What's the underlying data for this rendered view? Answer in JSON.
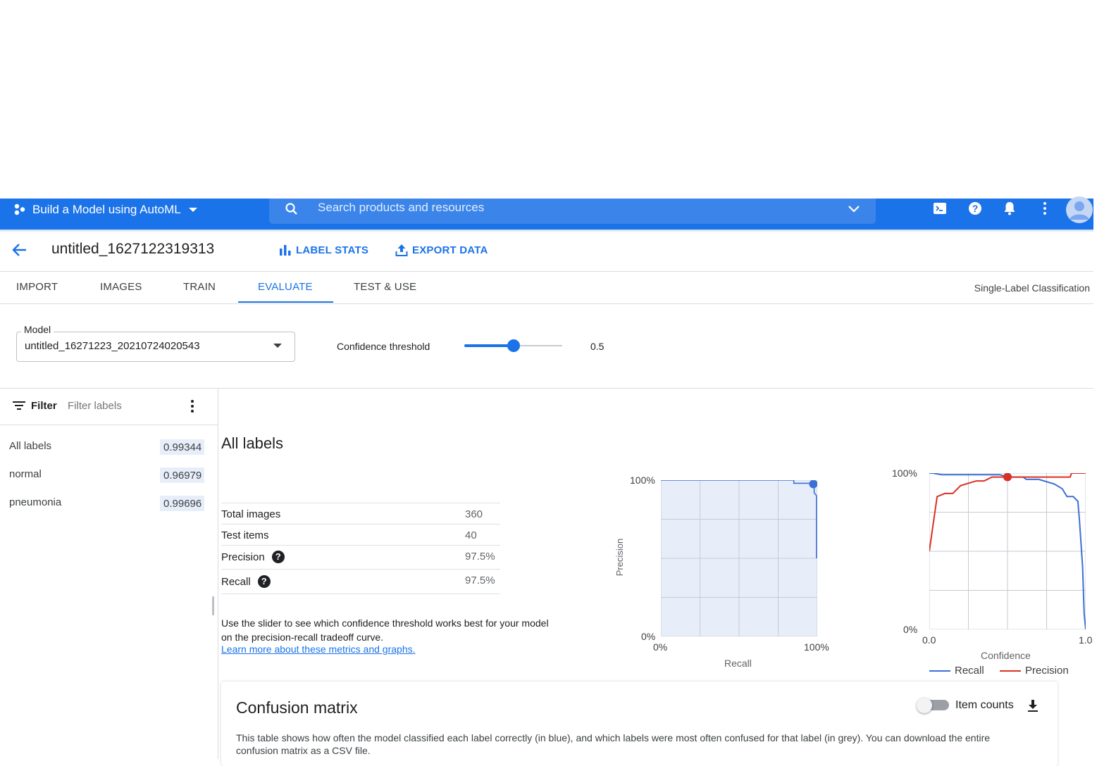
{
  "topbar": {
    "project": "Build a Model using AutoML",
    "search_placeholder": "Search products and resources",
    "icons": [
      "cloud-shell-icon",
      "help-icon",
      "notifications-icon",
      "more-vert-icon",
      "account-avatar"
    ]
  },
  "header": {
    "title": "untitled_1627122319313",
    "label_stats": "LABEL STATS",
    "export_data": "EXPORT DATA"
  },
  "tabs": [
    {
      "label": "IMPORT",
      "active": false
    },
    {
      "label": "IMAGES",
      "active": false
    },
    {
      "label": "TRAIN",
      "active": false
    },
    {
      "label": "EVALUATE",
      "active": true
    },
    {
      "label": "TEST & USE",
      "active": false
    }
  ],
  "task_type": "Single-Label Classification",
  "model_select": {
    "label": "Model",
    "value": "untitled_16271223_20210724020543"
  },
  "confidence": {
    "label": "Confidence threshold",
    "value": "0.5",
    "fraction": 0.5
  },
  "filter": {
    "label": "Filter",
    "placeholder": "Filter labels"
  },
  "labels": [
    {
      "name": "All labels",
      "score": "0.99344"
    },
    {
      "name": "normal",
      "score": "0.96979"
    },
    {
      "name": "pneumonia",
      "score": "0.99696"
    }
  ],
  "section_title": "All labels",
  "metrics": [
    {
      "key": "Total images",
      "value": "360"
    },
    {
      "key": "Test items",
      "value": "40"
    },
    {
      "key": "Precision",
      "value": "97.5%"
    },
    {
      "key": "Recall",
      "value": "97.5%"
    }
  ],
  "description": "Use the slider to see which confidence threshold works best for your model on the precision-recall tradeoff curve.",
  "learn_more": "Learn more about these metrics and graphs.",
  "charts_text": {
    "pr_y_top": "100%",
    "pr_y_bottom": "0%",
    "pr_x_left": "0%",
    "pr_x_right": "100%",
    "pr_xlabel": "Recall",
    "pr_ylabel": "Precision",
    "conf_y_top": "100%",
    "conf_y_bottom": "0%",
    "conf_x_left": "0.0",
    "conf_x_right": "1.0",
    "conf_xlabel": "Confidence",
    "legend_recall": "Recall",
    "legend_precision": "Precision"
  },
  "colors": {
    "accent": "#1a73e8",
    "recall": "#1a73e8",
    "precision": "#d93025",
    "pr_fill": "#e8eef9"
  },
  "chart_data": [
    {
      "type": "area",
      "xlabel": "Recall",
      "ylabel": "Precision",
      "xlim": [
        0,
        1
      ],
      "ylim": [
        0,
        1
      ],
      "grid": true,
      "series": [
        {
          "x": [
            0,
            0.85,
            0.85,
            0.95,
            0.975,
            0.98,
            0.98,
            0.995,
            0.995
          ],
          "y": [
            1,
            1,
            0.98,
            0.98,
            0.975,
            0.975,
            0.92,
            0.9,
            0.5
          ]
        }
      ],
      "highlight": {
        "x": 0.975,
        "y": 0.975
      }
    },
    {
      "type": "line",
      "xlabel": "Confidence",
      "xlim": [
        0,
        1
      ],
      "ylim": [
        0,
        1
      ],
      "grid": true,
      "legend": "bottom",
      "series": [
        {
          "name": "Recall",
          "x": [
            0,
            0.02,
            0.08,
            0.2,
            0.3,
            0.45,
            0.5,
            0.6,
            0.62,
            0.7,
            0.8,
            0.85,
            0.88,
            0.92,
            0.95,
            0.96,
            0.98,
            0.99,
            1.0
          ],
          "y": [
            1,
            1,
            0.99,
            0.99,
            0.99,
            0.99,
            0.975,
            0.975,
            0.96,
            0.96,
            0.93,
            0.9,
            0.85,
            0.85,
            0.82,
            0.7,
            0.4,
            0.1,
            0.0
          ]
        },
        {
          "name": "Precision",
          "x": [
            0,
            0.05,
            0.1,
            0.15,
            0.2,
            0.3,
            0.35,
            0.4,
            0.5,
            0.6,
            0.8,
            0.9,
            0.91,
            1.0
          ],
          "y": [
            0.5,
            0.85,
            0.87,
            0.87,
            0.92,
            0.95,
            0.95,
            0.975,
            0.975,
            0.975,
            0.975,
            0.975,
            1.0,
            1.0
          ]
        }
      ],
      "highlight": {
        "x": 0.5,
        "y": 0.975
      }
    }
  ],
  "confusion_matrix": {
    "title": "Confusion matrix",
    "toggle_label": "Item counts",
    "toggle_on": false,
    "description": "This table shows how often the model classified each label correctly (in blue), and which labels were most often confused for that label (in grey). You can download the entire",
    "description_cont": "confusion matrix as a CSV file."
  }
}
